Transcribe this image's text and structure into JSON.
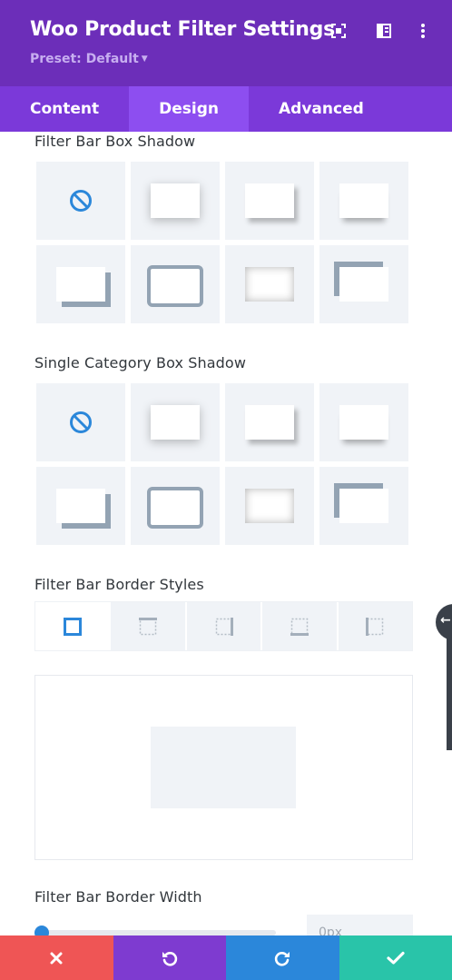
{
  "header": {
    "title": "Woo Product Filter Settings",
    "preset": "Preset: Default",
    "icons": [
      "fullscreen-icon",
      "split-view-icon",
      "more-options-icon"
    ]
  },
  "tabs": [
    {
      "label": "Content",
      "active": false
    },
    {
      "label": "Design",
      "active": true
    },
    {
      "label": "Advanced",
      "active": false
    }
  ],
  "sections": {
    "filter_bar_box_shadow": {
      "label": "Filter Bar Box Shadow",
      "options": [
        "none",
        "preset1",
        "preset2",
        "preset3",
        "preset4",
        "preset5",
        "preset6",
        "preset7"
      ]
    },
    "single_category_box_shadow": {
      "label": "Single Category Box Shadow",
      "options": [
        "none",
        "preset1",
        "preset2",
        "preset3",
        "preset4",
        "preset5",
        "preset6",
        "preset7"
      ]
    },
    "filter_bar_border_styles": {
      "label": "Filter Bar Border Styles",
      "tabs": [
        "all-sides",
        "top",
        "right",
        "bottom",
        "left"
      ],
      "active": "all-sides"
    },
    "filter_bar_border_width": {
      "label": "Filter Bar Border Width",
      "value": "0px"
    }
  },
  "footer": {
    "buttons": [
      "cancel",
      "undo",
      "redo",
      "save"
    ]
  },
  "colors": {
    "header_bg": "#6c2eb9",
    "tabs_bg": "#7b39d9",
    "active_tab_bg": "#8d4ef0",
    "accent_blue": "#2b87da",
    "cancel": "#ef5555",
    "undo": "#7e3bd0",
    "redo": "#2b87da",
    "save": "#29c4a9"
  }
}
